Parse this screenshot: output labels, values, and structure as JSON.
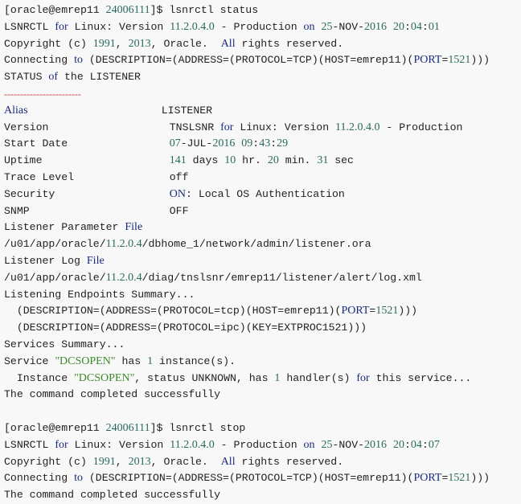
{
  "colors": {
    "background": "#f8f8f8",
    "text": "#222222",
    "keyword": "#1a2a7a",
    "number": "#2a6a5e",
    "string": "#3c8a2a",
    "separator": "#c0392b"
  },
  "lines": [
    [
      [
        "txt",
        "[oracle@emrep11 "
      ],
      [
        "num",
        "24006111"
      ],
      [
        "txt",
        "]$ lsnrctl status"
      ]
    ],
    [
      [
        "txt",
        "LSNRCTL "
      ],
      [
        "kw",
        "for"
      ],
      [
        "txt",
        " Linux: Version "
      ],
      [
        "num",
        "11.2.0.4.0"
      ],
      [
        "txt",
        " - Production "
      ],
      [
        "kw",
        "on"
      ],
      [
        "txt",
        " "
      ],
      [
        "num",
        "25"
      ],
      [
        "txt",
        "-NOV-"
      ],
      [
        "num",
        "2016"
      ],
      [
        "txt",
        " "
      ],
      [
        "num",
        "20"
      ],
      [
        "txt",
        ":"
      ],
      [
        "num",
        "04"
      ],
      [
        "txt",
        ":"
      ],
      [
        "num",
        "01"
      ]
    ],
    [
      [
        "txt",
        "Copyright (c) "
      ],
      [
        "num",
        "1991"
      ],
      [
        "txt",
        ", "
      ],
      [
        "num",
        "2013"
      ],
      [
        "txt",
        ", Oracle.  "
      ],
      [
        "kw",
        "All"
      ],
      [
        "txt",
        " rights reserved."
      ]
    ],
    [
      [
        "txt",
        "Connecting "
      ],
      [
        "kw",
        "to"
      ],
      [
        "txt",
        " (DESCRIPTION=(ADDRESS=(PROTOCOL=TCP)(HOST=emrep11)("
      ],
      [
        "kw",
        "PORT"
      ],
      [
        "txt",
        "="
      ],
      [
        "num",
        "1521"
      ],
      [
        "txt",
        ")))"
      ]
    ],
    [
      [
        "txt",
        "STATUS "
      ],
      [
        "kw",
        "of"
      ],
      [
        "txt",
        " the LISTENER"
      ]
    ],
    [
      [
        "dash",
        "------------------------"
      ]
    ],
    [
      [
        "kw",
        "Alias"
      ],
      [
        "txt",
        "                     LISTENER"
      ]
    ],
    [
      [
        "txt",
        "Version                   TNSLSNR "
      ],
      [
        "kw",
        "for"
      ],
      [
        "txt",
        " Linux: Version "
      ],
      [
        "num",
        "11.2.0.4.0"
      ],
      [
        "txt",
        " - Production"
      ]
    ],
    [
      [
        "txt",
        "Start Date                "
      ],
      [
        "num",
        "07"
      ],
      [
        "txt",
        "-JUL-"
      ],
      [
        "num",
        "2016"
      ],
      [
        "txt",
        " "
      ],
      [
        "num",
        "09"
      ],
      [
        "txt",
        ":"
      ],
      [
        "num",
        "43"
      ],
      [
        "txt",
        ":"
      ],
      [
        "num",
        "29"
      ]
    ],
    [
      [
        "txt",
        "Uptime                    "
      ],
      [
        "num",
        "141"
      ],
      [
        "txt",
        " days "
      ],
      [
        "num",
        "10"
      ],
      [
        "txt",
        " hr. "
      ],
      [
        "num",
        "20"
      ],
      [
        "txt",
        " min. "
      ],
      [
        "num",
        "31"
      ],
      [
        "txt",
        " sec"
      ]
    ],
    [
      [
        "txt",
        "Trace Level               off"
      ]
    ],
    [
      [
        "txt",
        "Security                  "
      ],
      [
        "kw",
        "ON"
      ],
      [
        "txt",
        ": Local OS Authentication"
      ]
    ],
    [
      [
        "txt",
        "SNMP                      OFF"
      ]
    ],
    [
      [
        "txt",
        "Listener Parameter "
      ],
      [
        "kw",
        "File"
      ]
    ],
    [
      [
        "txt",
        "/u01/app/oracle/"
      ],
      [
        "num",
        "11.2.0.4"
      ],
      [
        "txt",
        "/dbhome_1/network/admin/listener.ora"
      ]
    ],
    [
      [
        "txt",
        "Listener Log "
      ],
      [
        "kw",
        "File"
      ]
    ],
    [
      [
        "txt",
        "/u01/app/oracle/"
      ],
      [
        "num",
        "11.2.0.4"
      ],
      [
        "txt",
        "/diag/tnslsnr/emrep11/listener/alert/log.xml"
      ]
    ],
    [
      [
        "txt",
        "Listening Endpoints Summary..."
      ]
    ],
    [
      [
        "txt",
        "  (DESCRIPTION=(ADDRESS=(PROTOCOL=tcp)(HOST=emrep11)("
      ],
      [
        "kw",
        "PORT"
      ],
      [
        "txt",
        "="
      ],
      [
        "num",
        "1521"
      ],
      [
        "txt",
        ")))"
      ]
    ],
    [
      [
        "txt",
        "  (DESCRIPTION=(ADDRESS=(PROTOCOL=ipc)(KEY=EXTPROC1521)))"
      ]
    ],
    [
      [
        "txt",
        "Services Summary..."
      ]
    ],
    [
      [
        "txt",
        "Service "
      ],
      [
        "str",
        "\"DCSOPEN\""
      ],
      [
        "txt",
        " has "
      ],
      [
        "num",
        "1"
      ],
      [
        "txt",
        " instance(s)."
      ]
    ],
    [
      [
        "txt",
        "  Instance "
      ],
      [
        "str",
        "\"DCSOPEN\""
      ],
      [
        "txt",
        ", status UNKNOWN, has "
      ],
      [
        "num",
        "1"
      ],
      [
        "txt",
        " handler(s) "
      ],
      [
        "kw",
        "for"
      ],
      [
        "txt",
        " this service..."
      ]
    ],
    [
      [
        "txt",
        "The command completed successfully"
      ]
    ],
    [
      [
        "txt",
        ""
      ]
    ],
    [
      [
        "txt",
        "[oracle@emrep11 "
      ],
      [
        "num",
        "24006111"
      ],
      [
        "txt",
        "]$ lsnrctl stop"
      ]
    ],
    [
      [
        "txt",
        "LSNRCTL "
      ],
      [
        "kw",
        "for"
      ],
      [
        "txt",
        " Linux: Version "
      ],
      [
        "num",
        "11.2.0.4.0"
      ],
      [
        "txt",
        " - Production "
      ],
      [
        "kw",
        "on"
      ],
      [
        "txt",
        " "
      ],
      [
        "num",
        "25"
      ],
      [
        "txt",
        "-NOV-"
      ],
      [
        "num",
        "2016"
      ],
      [
        "txt",
        " "
      ],
      [
        "num",
        "20"
      ],
      [
        "txt",
        ":"
      ],
      [
        "num",
        "04"
      ],
      [
        "txt",
        ":"
      ],
      [
        "num",
        "07"
      ]
    ],
    [
      [
        "txt",
        "Copyright (c) "
      ],
      [
        "num",
        "1991"
      ],
      [
        "txt",
        ", "
      ],
      [
        "num",
        "2013"
      ],
      [
        "txt",
        ", Oracle.  "
      ],
      [
        "kw",
        "All"
      ],
      [
        "txt",
        " rights reserved."
      ]
    ],
    [
      [
        "txt",
        "Connecting "
      ],
      [
        "kw",
        "to"
      ],
      [
        "txt",
        " (DESCRIPTION=(ADDRESS=(PROTOCOL=TCP)(HOST=emrep11)("
      ],
      [
        "kw",
        "PORT"
      ],
      [
        "txt",
        "="
      ],
      [
        "num",
        "1521"
      ],
      [
        "txt",
        ")))"
      ]
    ],
    [
      [
        "txt",
        "The command completed successfully"
      ]
    ]
  ]
}
